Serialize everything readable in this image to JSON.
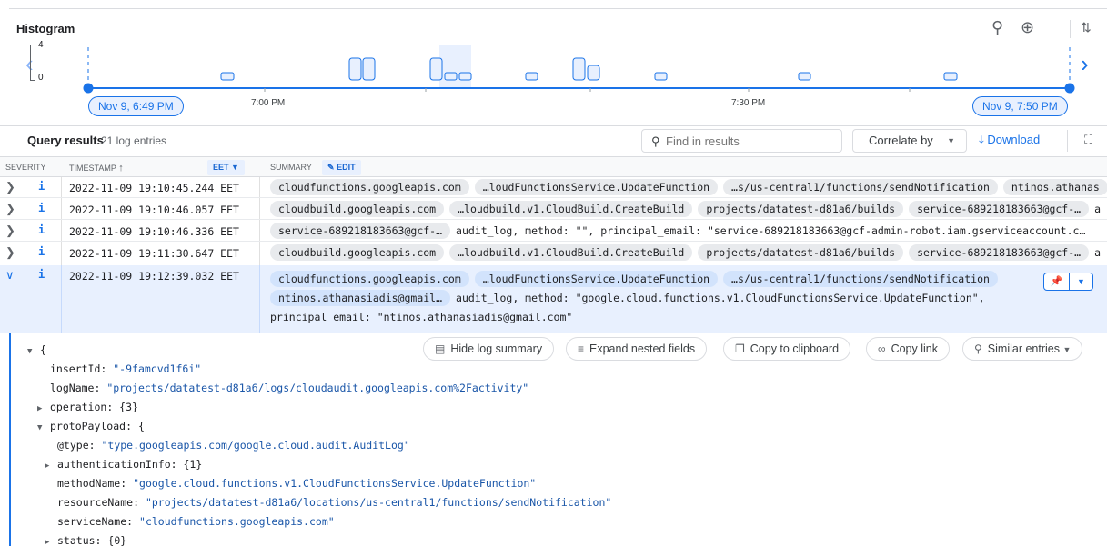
{
  "histogram": {
    "title": "Histogram",
    "y_max": "4",
    "y_min": "0",
    "range_start": "Nov 9, 6:49 PM",
    "range_end": "Nov 9, 7:50 PM",
    "time_labels": [
      "7:00 PM",
      "7:30 PM"
    ],
    "accent": "#1a73e8"
  },
  "query_results": {
    "title": "Query results",
    "count": "21 log entries",
    "find_placeholder": "Find in results",
    "correlate_label": "Correlate by",
    "download_label": "Download"
  },
  "table": {
    "headers": {
      "severity": "SEVERITY",
      "timestamp": "TIMESTAMP",
      "tz": "EET",
      "summary": "SUMMARY",
      "edit": "EDIT"
    },
    "rows": [
      {
        "timestamp": "2022-11-09 19:10:45.244 EET",
        "chips": [
          "cloudfunctions.googleapis.com",
          "…loudFunctionsService.UpdateFunction",
          "…s/us-central1/functions/sendNotification",
          "ntinos.athanas"
        ],
        "text": ""
      },
      {
        "timestamp": "2022-11-09 19:10:46.057 EET",
        "chips": [
          "cloudbuild.googleapis.com",
          "…loudbuild.v1.CloudBuild.CreateBuild",
          "projects/datatest-d81a6/builds",
          "service-689218183663@gcf-…"
        ],
        "text": "a"
      },
      {
        "timestamp": "2022-11-09 19:10:46.336 EET",
        "chips": [
          "service-689218183663@gcf-…"
        ],
        "text": "audit_log, method: \"\", principal_email: \"service-689218183663@gcf-admin-robot.iam.gserviceaccount.c…"
      },
      {
        "timestamp": "2022-11-09 19:11:30.647 EET",
        "chips": [
          "cloudbuild.googleapis.com",
          "…loudbuild.v1.CloudBuild.CreateBuild",
          "projects/datatest-d81a6/builds",
          "service-689218183663@gcf-…"
        ],
        "text": "a"
      }
    ],
    "expanded_row": {
      "timestamp": "2022-11-09 19:12:39.032 EET",
      "chips": [
        "cloudfunctions.googleapis.com",
        "…loudFunctionsService.UpdateFunction",
        "…s/us-central1/functions/sendNotification"
      ],
      "chip_line2": "ntinos.athanasiadis@gmail…",
      "text_line2": "audit_log, method: \"google.cloud.functions.v1.CloudFunctionsService.UpdateFunction\",",
      "text_line3": "principal_email: \"ntinos.athanasiadis@gmail.com\""
    }
  },
  "actions": {
    "hide_summary": "Hide log summary",
    "expand_nested": "Expand nested fields",
    "copy_clipboard": "Copy to clipboard",
    "copy_link": "Copy link",
    "similar_entries": "Similar entries"
  },
  "json": {
    "open_brace": "{",
    "insertId_key": "insertId",
    "insertId_val": "\"-9famcvd1f6i\"",
    "logName_key": "logName",
    "logName_val": "\"projects/datatest-d81a6/logs/cloudaudit.googleapis.com%2Factivity\"",
    "operation_key": "operation",
    "operation_val": "{3}",
    "protoPayload_key": "protoPayload",
    "protoPayload_val": "{",
    "type_key": "@type",
    "type_val": "\"type.googleapis.com/google.cloud.audit.AuditLog\"",
    "authInfo_key": "authenticationInfo",
    "authInfo_val": "{1}",
    "methodName_key": "methodName",
    "methodName_val": "\"google.cloud.functions.v1.CloudFunctionsService.UpdateFunction\"",
    "resourceName_key": "resourceName",
    "resourceName_val": "\"projects/datatest-d81a6/locations/us-central1/functions/sendNotification\"",
    "serviceName_key": "serviceName",
    "serviceName_val": "\"cloudfunctions.googleapis.com\"",
    "status_key": "status",
    "status_val": "{0}"
  }
}
